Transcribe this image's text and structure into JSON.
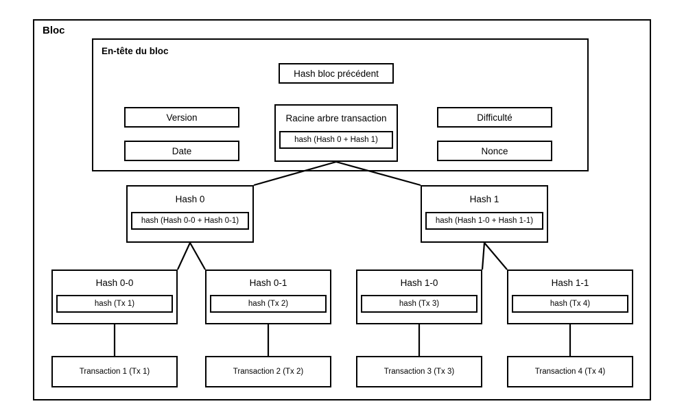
{
  "diagram": {
    "title": "Bloc",
    "language": "fr",
    "header": {
      "title": "En-tête du bloc",
      "fields": [
        {
          "id": "prev-hash",
          "label": "Hash bloc précédent"
        },
        {
          "id": "version",
          "label": "Version"
        },
        {
          "id": "date",
          "label": "Date"
        },
        {
          "id": "difficulte",
          "label": "Difficulté"
        },
        {
          "id": "nonce",
          "label": "Nonce"
        }
      ],
      "merkle_root": {
        "title": "Racine arbre transaction",
        "formula": "hash (Hash 0 + Hash 1)"
      }
    },
    "merkle_tree": {
      "level1": [
        {
          "id": "hash-0",
          "title": "Hash 0",
          "formula": "hash (Hash 0-0 + Hash 0-1)"
        },
        {
          "id": "hash-1",
          "title": "Hash 1",
          "formula": "hash (Hash 1-0 + Hash 1-1)"
        }
      ],
      "level2": [
        {
          "id": "hash-0-0",
          "title": "Hash 0-0",
          "formula": "hash (Tx 1)"
        },
        {
          "id": "hash-0-1",
          "title": "Hash 0-1",
          "formula": "hash (Tx 2)"
        },
        {
          "id": "hash-1-0",
          "title": "Hash 1-0",
          "formula": "hash (Tx 3)"
        },
        {
          "id": "hash-1-1",
          "title": "Hash 1-1",
          "formula": "hash (Tx 4)"
        }
      ],
      "transactions": [
        {
          "id": "tx-1",
          "label": "Transaction 1 (Tx 1)"
        },
        {
          "id": "tx-2",
          "label": "Transaction 2 (Tx 2)"
        },
        {
          "id": "tx-3",
          "label": "Transaction 3 (Tx 3)"
        },
        {
          "id": "tx-4",
          "label": "Transaction 4 (Tx 4)"
        }
      ]
    },
    "colors": {
      "stroke": "#000000",
      "background": "#ffffff",
      "text": "#000000"
    }
  }
}
